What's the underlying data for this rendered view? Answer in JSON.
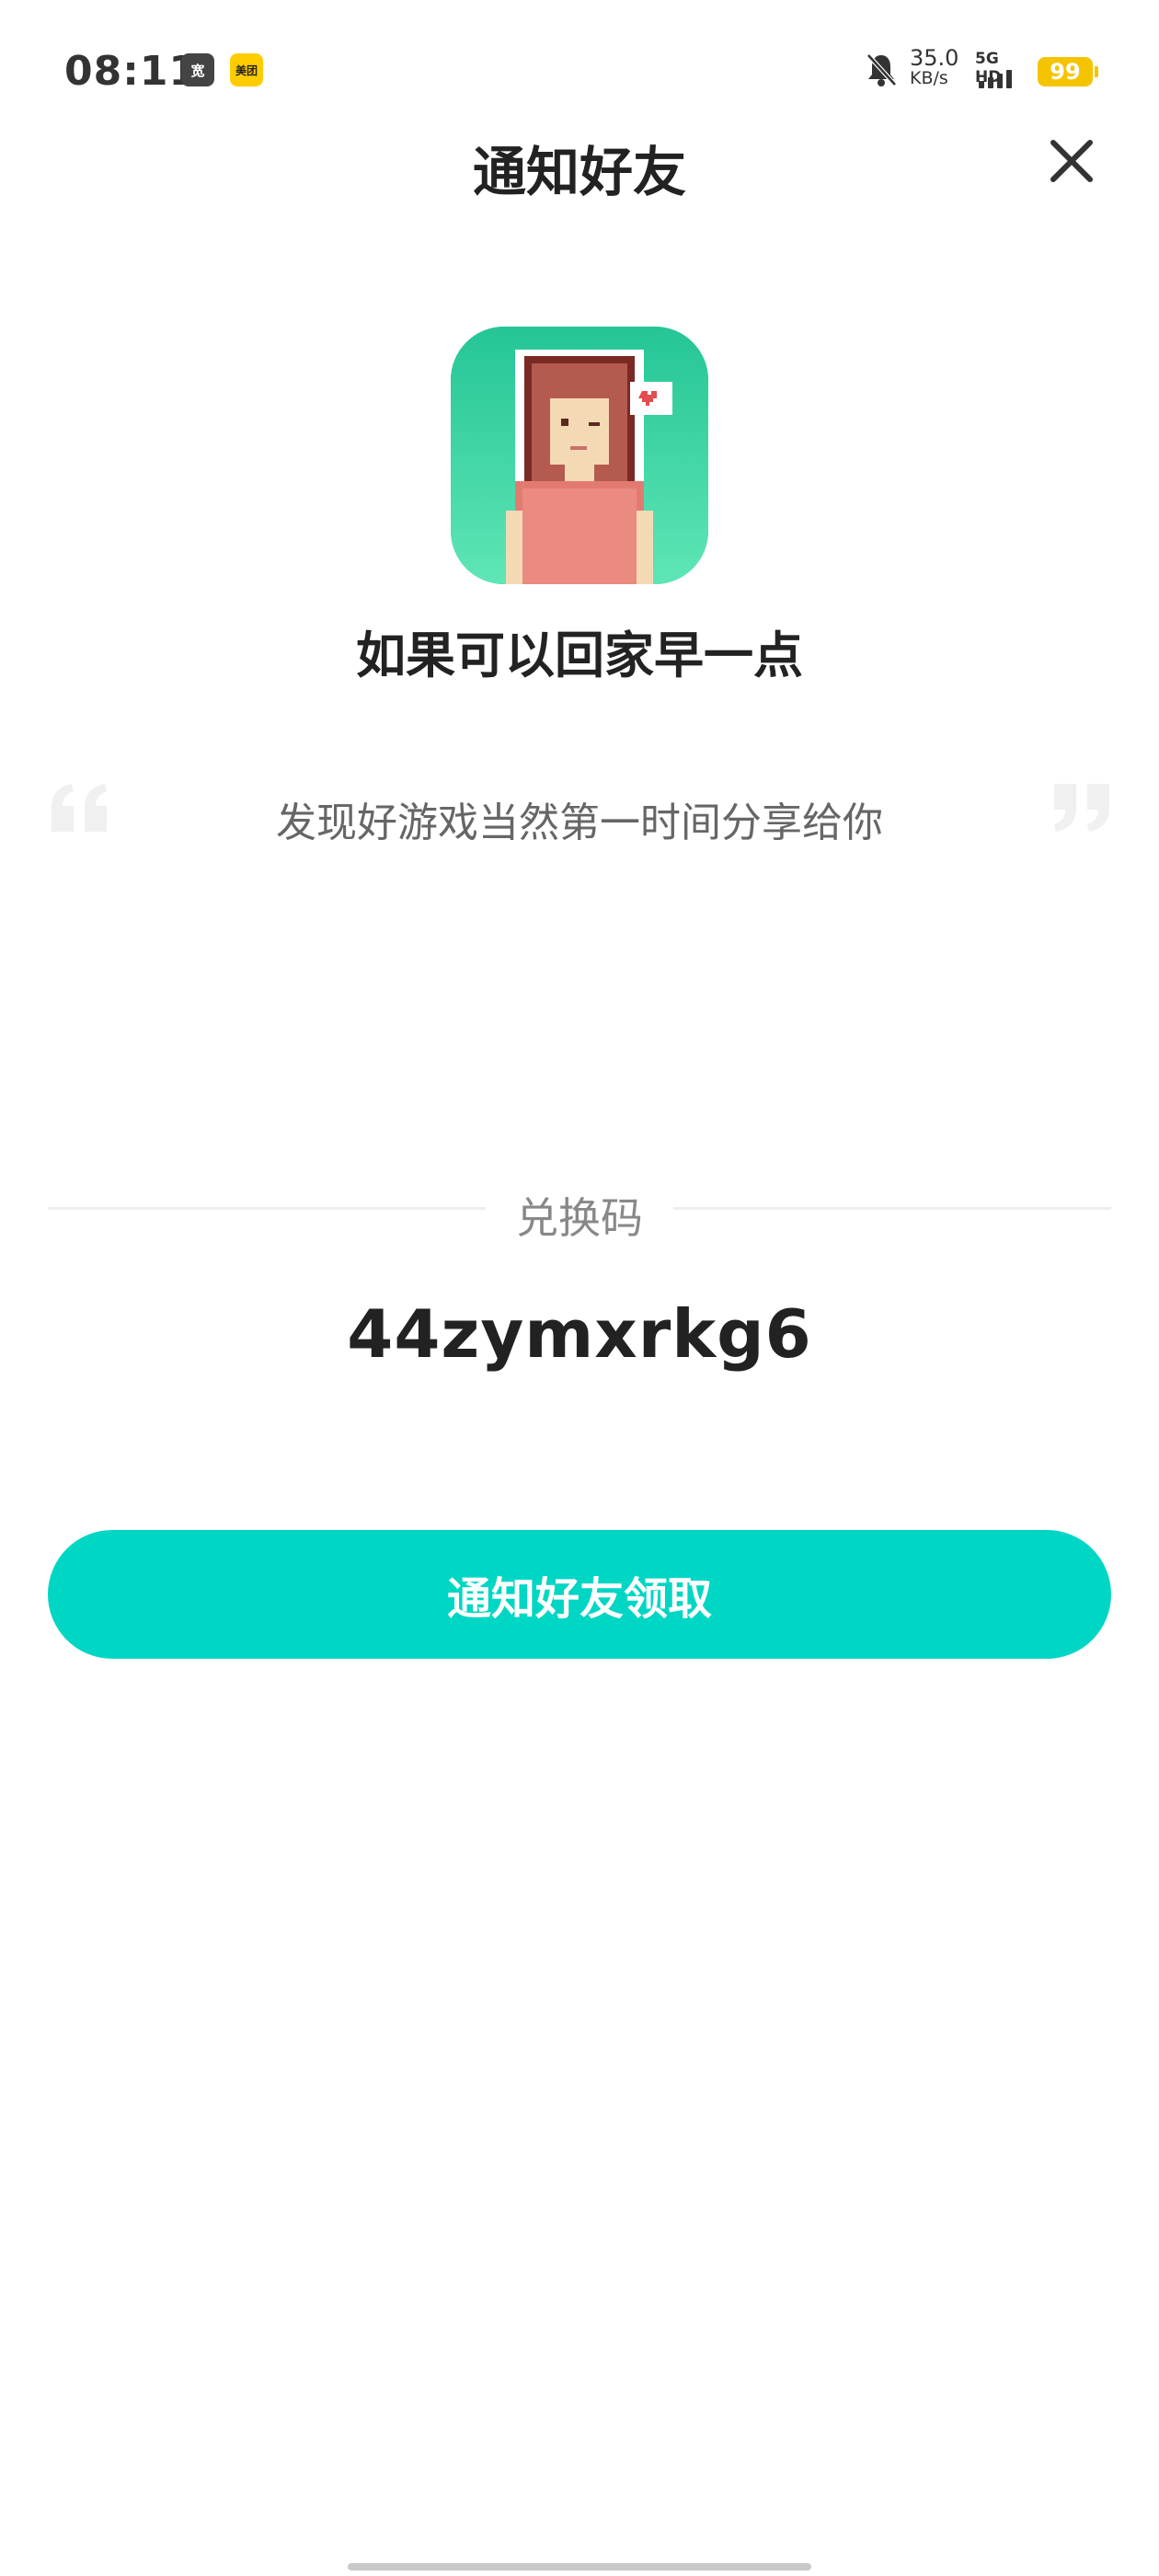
{
  "status_bar": {
    "time": "08:11",
    "app_icon_1": "宽",
    "app_icon_2": "美团",
    "net_speed_value": "35.0",
    "net_speed_unit": "KB/s",
    "network_label": "5G HD",
    "battery": "99",
    "icons": [
      "bell-muted-icon",
      "signal-icon",
      "battery-icon"
    ]
  },
  "header": {
    "title": "通知好友",
    "close_icon": "close-icon"
  },
  "game": {
    "name": "如果可以回家早一点",
    "icon": "game-pixel-art-icon"
  },
  "share": {
    "text": "发现好游戏当然第一时间分享给你"
  },
  "code": {
    "label": "兑换码",
    "value": "44zymxrkg6"
  },
  "action": {
    "button_label": "通知好友领取"
  },
  "colors": {
    "accent": "#00d6c4",
    "battery": "#f5c400"
  }
}
